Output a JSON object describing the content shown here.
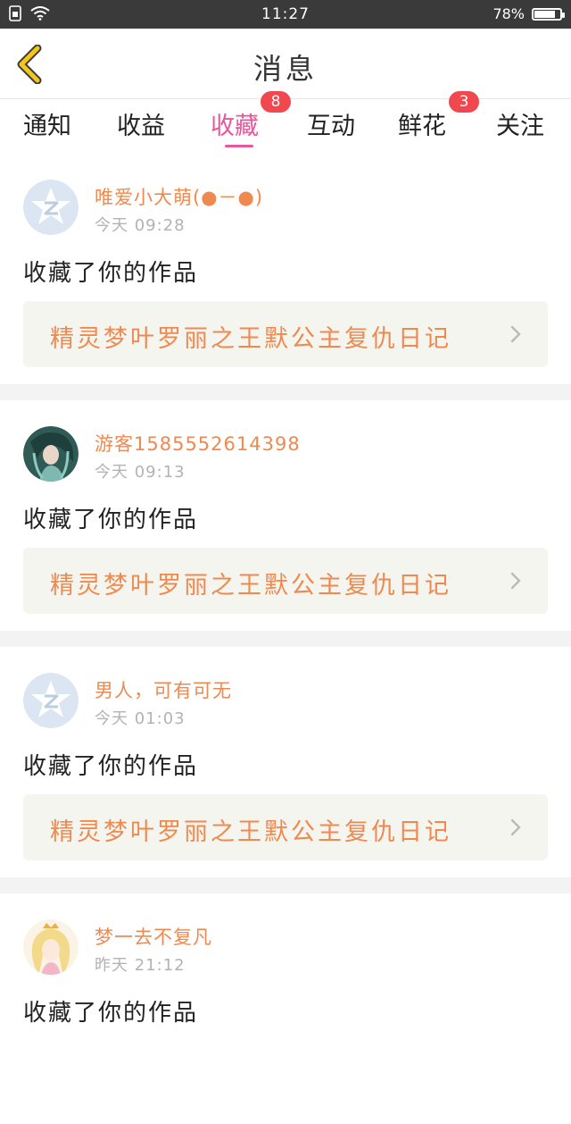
{
  "status_bar": {
    "time": "11:27",
    "battery": "78%",
    "battery_level": 0.78
  },
  "header": {
    "title": "消息"
  },
  "tabs": [
    {
      "label": "通知",
      "badge": ""
    },
    {
      "label": "收益",
      "badge": ""
    },
    {
      "label": "收藏",
      "badge": "8"
    },
    {
      "label": "互动",
      "badge": ""
    },
    {
      "label": "鲜花",
      "badge": "3"
    },
    {
      "label": "关注",
      "badge": ""
    }
  ],
  "active_tab": "收藏",
  "messages": [
    {
      "username": "唯爱小大萌(●－●)",
      "time": "今天 09:28",
      "action": "收藏了你的作品",
      "work_title": "精灵梦叶罗丽之王默公主复仇日记",
      "avatar": "default-avatar"
    },
    {
      "username": "游客15855526143​98",
      "time": "今天 09:13",
      "action": "收藏了你的作品",
      "work_title": "精灵梦叶罗丽之王默公主复仇日记",
      "avatar": "character-avatar"
    },
    {
      "username": "男人，可有可无",
      "time": "今天 01:03",
      "action": "收藏了你的作品",
      "work_title": "精灵梦叶罗丽之王默公主复仇日记",
      "avatar": "default-avatar"
    },
    {
      "username": "梦一去不复凡",
      "time": "昨天 21:12",
      "action": "收藏了你的作品",
      "work_title": "",
      "avatar": "princess-avatar"
    }
  ],
  "colors": {
    "accent": "#e8569b",
    "username": "#f0894f",
    "badge": "#f0484e",
    "back_arrow": "#f5c518"
  }
}
